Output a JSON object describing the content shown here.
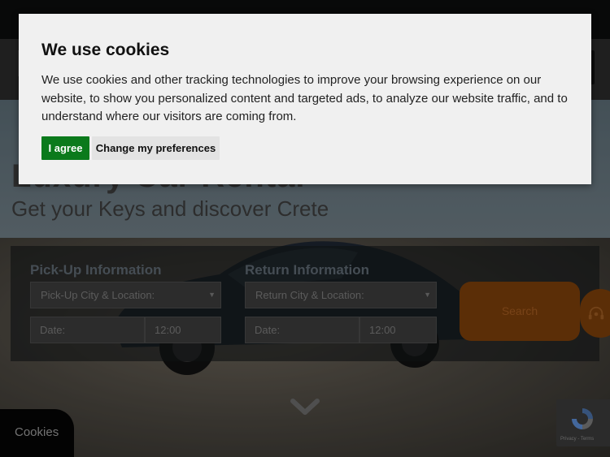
{
  "hero": {
    "title": "Luxury Car Rental",
    "subtitle": "Get your Keys and discover Crete"
  },
  "search_form": {
    "pickup": {
      "heading": "Pick-Up Information",
      "location_selected": "Pick-Up City & Location:",
      "date_placeholder": "Date:",
      "time_value": "12:00"
    },
    "return": {
      "heading": "Return Information",
      "location_selected": "Return City & Location:",
      "date_placeholder": "Date:",
      "time_value": "12:00"
    },
    "search_label": "Search"
  },
  "help_button": {
    "icon": "headset-icon"
  },
  "scroll_down": {
    "icon": "chevron-down-icon"
  },
  "recaptcha": {
    "text": "Privacy - Terms"
  },
  "cookies_tab": {
    "label": "Cookies"
  },
  "cookie_banner": {
    "title": "We use cookies",
    "body": "We use cookies and other tracking technologies to improve your browsing experience on our website, to show you personalized content and targeted ads, to analyze our website traffic, and to understand where our visitors are coming from.",
    "agree_label": "I agree",
    "preferences_label": "Change my preferences"
  },
  "colors": {
    "agree_button": "#0b7a1c",
    "search_button": "#7a3e0a",
    "dialog_background": "#f0f0f0"
  }
}
